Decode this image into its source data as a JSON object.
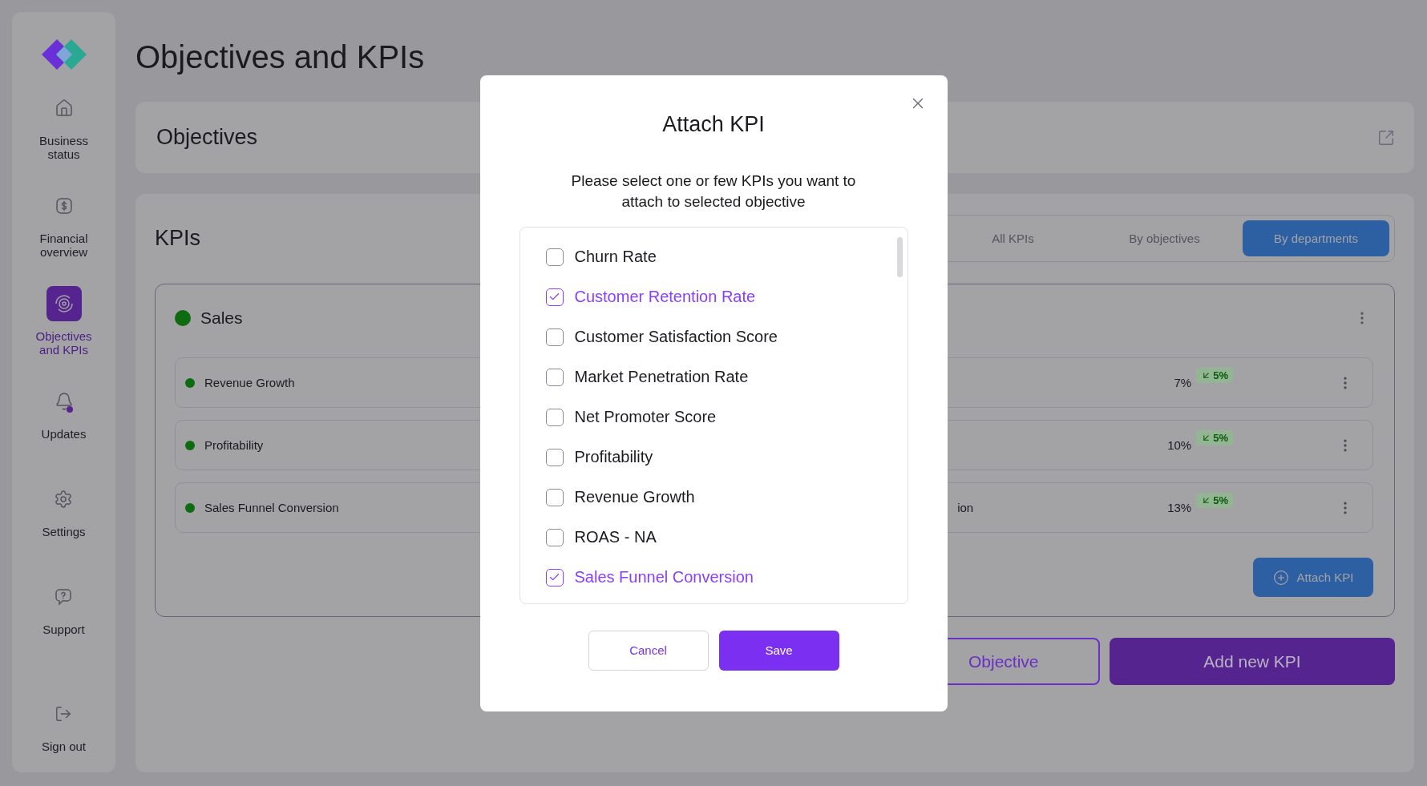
{
  "sidebar": {
    "items": [
      {
        "label": "Business status",
        "selected": false,
        "notification": false
      },
      {
        "label": "Financial overview",
        "selected": false,
        "notification": false
      },
      {
        "label": "Objectives and KPIs",
        "selected": true,
        "notification": false
      },
      {
        "label": "Updates",
        "selected": false,
        "notification": true
      },
      {
        "label": "Settings",
        "selected": false,
        "notification": false
      },
      {
        "label": "Support",
        "selected": false,
        "notification": false
      }
    ],
    "sign_out": {
      "label": "Sign out"
    }
  },
  "page_title": "Objectives and KPIs",
  "objectives_panel": {
    "title": "Objectives"
  },
  "kpis_panel": {
    "title": "KPIs",
    "tabs": [
      {
        "label": "All KPIs",
        "selected": false
      },
      {
        "label": "By objectives",
        "selected": false
      },
      {
        "label": "By departments",
        "selected": true
      }
    ],
    "department": {
      "name": "Sales",
      "color": "#0d6b12",
      "kpis": [
        {
          "name": "Revenue Growth",
          "color": "#0d6b12",
          "value": "7%",
          "change": "5%"
        },
        {
          "name": "Profitability",
          "color": "#0d6b12",
          "value": "10%",
          "change": "5%"
        },
        {
          "name": "Sales Funnel Conversion",
          "color": "#0d6b12",
          "column_2": "ion",
          "value": "13%",
          "change": "5%"
        }
      ],
      "attach_button": "Attach KPI"
    }
  },
  "actions": [
    {
      "label": "Objective",
      "kind": "outline"
    },
    {
      "label": "Add new KPI",
      "kind": "filled"
    }
  ],
  "modal": {
    "title": "Attach KPI",
    "description": "Please select one or few KPIs you want to attach to selected objective",
    "options": [
      {
        "label": "Churn Rate",
        "checked": false
      },
      {
        "label": "Customer Retention Rate",
        "checked": true
      },
      {
        "label": "Customer Satisfaction Score",
        "checked": false
      },
      {
        "label": "Market Penetration Rate",
        "checked": false
      },
      {
        "label": "Net Promoter Score",
        "checked": false
      },
      {
        "label": "Profitability",
        "checked": false
      },
      {
        "label": "Revenue Growth",
        "checked": false
      },
      {
        "label": "ROAS - NA",
        "checked": false
      },
      {
        "label": "Sales Funnel Conversion",
        "checked": true
      }
    ],
    "buttons": [
      {
        "label": "Cancel",
        "kind": "secondary"
      },
      {
        "label": "Save",
        "kind": "primary"
      }
    ]
  }
}
